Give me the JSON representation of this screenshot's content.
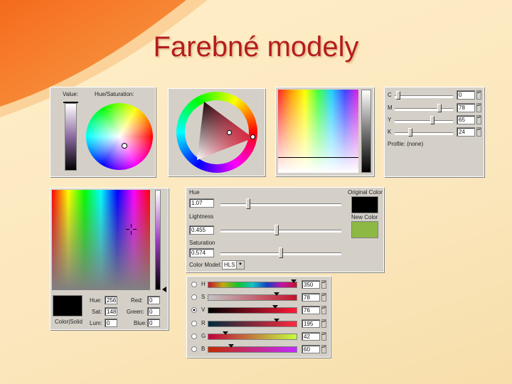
{
  "slide": {
    "title": "Farebné modely"
  },
  "picker1": {
    "value_label": "Value:",
    "hue_saturation_label": "Hue/Saturation:"
  },
  "cmyk": {
    "rows": [
      {
        "label": "C",
        "value": "0"
      },
      {
        "label": "M",
        "value": "78"
      },
      {
        "label": "Y",
        "value": "65"
      },
      {
        "label": "K",
        "value": "24"
      }
    ],
    "profile_label": "Profile: (none)"
  },
  "picker5": {
    "hue_label": "Hue:",
    "hue_value": "256",
    "sat_label": "Sat:",
    "sat_value": "148",
    "lum_label": "Lum:",
    "lum_value": "0",
    "red_label": "Red:",
    "red_value": "0",
    "green_label": "Green:",
    "green_value": "0",
    "blue_label": "Blue:",
    "blue_value": "0",
    "color_solid_label": "Color|Solid"
  },
  "hls": {
    "hue_label": "Hue",
    "hue_value": "1.07",
    "lightness_label": "Lightness",
    "lightness_value": "0.455",
    "saturation_label": "Saturation",
    "saturation_value": "0.574",
    "original_label": "Original Color",
    "new_label": "New Color",
    "model_label": "Color Model:",
    "model_value": "HLS",
    "original_color": "#000000",
    "new_color": "#8db843"
  },
  "sliders": {
    "rows": [
      {
        "label": "H",
        "value": "350",
        "checked": false
      },
      {
        "label": "S",
        "value": "78",
        "checked": false
      },
      {
        "label": "V",
        "value": "76",
        "checked": true
      },
      {
        "label": "R",
        "value": "195",
        "checked": false
      },
      {
        "label": "G",
        "value": "42",
        "checked": false
      },
      {
        "label": "B",
        "value": "60",
        "checked": false
      }
    ]
  }
}
